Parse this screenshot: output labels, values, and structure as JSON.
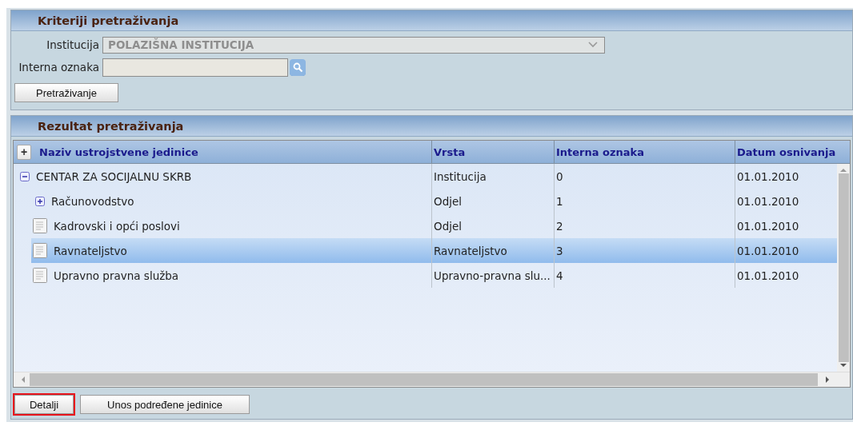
{
  "criteria": {
    "title": "Kriteriji pretraživanja",
    "fields": [
      {
        "kind": "select",
        "label": "Institucija",
        "value": "POLAZIŠNA INSTITUCIJA",
        "disabled": true
      },
      {
        "kind": "lookup",
        "label": "Interna oznaka"
      }
    ],
    "search_button": "Pretraživanje"
  },
  "results": {
    "title": "Rezultat pretraživanja",
    "expand_all": "+",
    "columns": [
      "Naziv ustrojstvene jedinice",
      "Vrsta",
      "Interna oznaka",
      "Datum osnivanja"
    ],
    "rows": [
      {
        "kind": "node",
        "expanded": true,
        "selected": false,
        "cells": [
          "CENTAR ZA SOCIJALNU SKRB",
          "Institucija",
          "0",
          "01.01.2010"
        ],
        "children": [
          {
            "kind": "node",
            "expanded": false,
            "selected": false,
            "cells": [
              "Računovodstvo",
              "Odjel",
              "1",
              "01.01.2010"
            ]
          },
          {
            "kind": "leaf",
            "selected": false,
            "cells": [
              "Kadrovski i opći poslovi",
              "Odjel",
              "2",
              "01.01.2010"
            ]
          },
          {
            "kind": "leaf",
            "selected": true,
            "cells": [
              "Ravnateljstvo",
              "Ravnateljstvo",
              "3",
              "01.01.2010"
            ]
          },
          {
            "kind": "leaf",
            "selected": false,
            "cells": [
              "Upravno pravna služba",
              "Upravno-pravna slu...",
              "4",
              "01.01.2010"
            ]
          }
        ]
      }
    ]
  },
  "buttons": [
    {
      "label": "Detalji",
      "highlighted": true
    },
    {
      "label": "Unos podređene jedinice",
      "highlighted": false
    }
  ]
}
